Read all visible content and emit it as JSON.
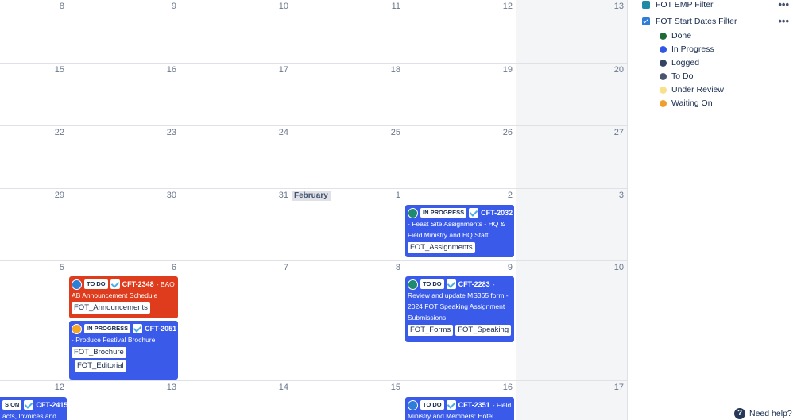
{
  "calendar": {
    "month_label": "February",
    "days": {
      "r0": [
        "8",
        "9",
        "10",
        "11",
        "12",
        "13"
      ],
      "r1": [
        "15",
        "16",
        "17",
        "18",
        "19",
        "20"
      ],
      "r2": [
        "22",
        "23",
        "24",
        "25",
        "26",
        "27"
      ],
      "r3": [
        "29",
        "30",
        "31",
        "1",
        "2",
        "3"
      ],
      "r4": [
        "5",
        "6",
        "7",
        "8",
        "9",
        "10"
      ],
      "r5": [
        "12",
        "13",
        "14",
        "15",
        "16",
        "17"
      ]
    },
    "events": [
      {
        "status": "IN PROGRESS",
        "key": "CFT-2032",
        "title": "- Feast Site Assignments - HQ & Field Ministry and HQ Staff",
        "labels": [
          "FOT_Assignments"
        ],
        "color": "#3a5bea",
        "avatar_color": "#1f8a70"
      },
      {
        "status": "TO DO",
        "key": "CFT-2348",
        "title_inline": "- BAO",
        "title": "AB Announcement Schedule",
        "labels": [
          "FOT_Announcements"
        ],
        "color": "#de3c1c",
        "avatar_color": "#2e7dd7"
      },
      {
        "status": "IN PROGRESS",
        "key": "CFT-2051",
        "title": "- Produce Festival Brochure",
        "labels": [
          "FOT_Brochure",
          "FOT_Editorial"
        ],
        "color": "#3a5bea",
        "avatar_color": "#f5a623"
      },
      {
        "status": "TO DO",
        "key": "CFT-2283",
        "title_inline": "-",
        "title": "Review and update MS365 form - 2024 FOT Speaking Assignment Submissions",
        "labels": [
          "FOT_Forms",
          "FOT_Speaking"
        ],
        "color": "#3a5bea",
        "avatar_color": "#1f8a70"
      },
      {
        "status": "S ON",
        "key": "CFT-2415",
        "title_inline": "-",
        "title": "acts, Invoices and",
        "color": "#3a5bea"
      },
      {
        "status": "TO DO",
        "key": "CFT-2351",
        "title_inline": "- Field",
        "title": "Ministry and Members: Hotel",
        "color": "#3a5bea",
        "avatar_color": "#2e7dd7"
      }
    ]
  },
  "filters": {
    "items": [
      {
        "name": "FOT EMP Filter",
        "color": "#1f8aa5"
      },
      {
        "name": "FOT Start Dates Filter",
        "color": "#2e7dd7"
      }
    ],
    "more_label": "•••",
    "legend": [
      {
        "label": "Done",
        "color": "#1e6b3a"
      },
      {
        "label": "In Progress",
        "color": "#2f57e4"
      },
      {
        "label": "Logged",
        "color": "#344563"
      },
      {
        "label": "To Do",
        "color": "#4a5670"
      },
      {
        "label": "Under Review",
        "color": "#f9e08a"
      },
      {
        "label": "Waiting On",
        "color": "#f0a02a"
      }
    ]
  },
  "help": {
    "icon": "?",
    "label": "Need help?"
  }
}
